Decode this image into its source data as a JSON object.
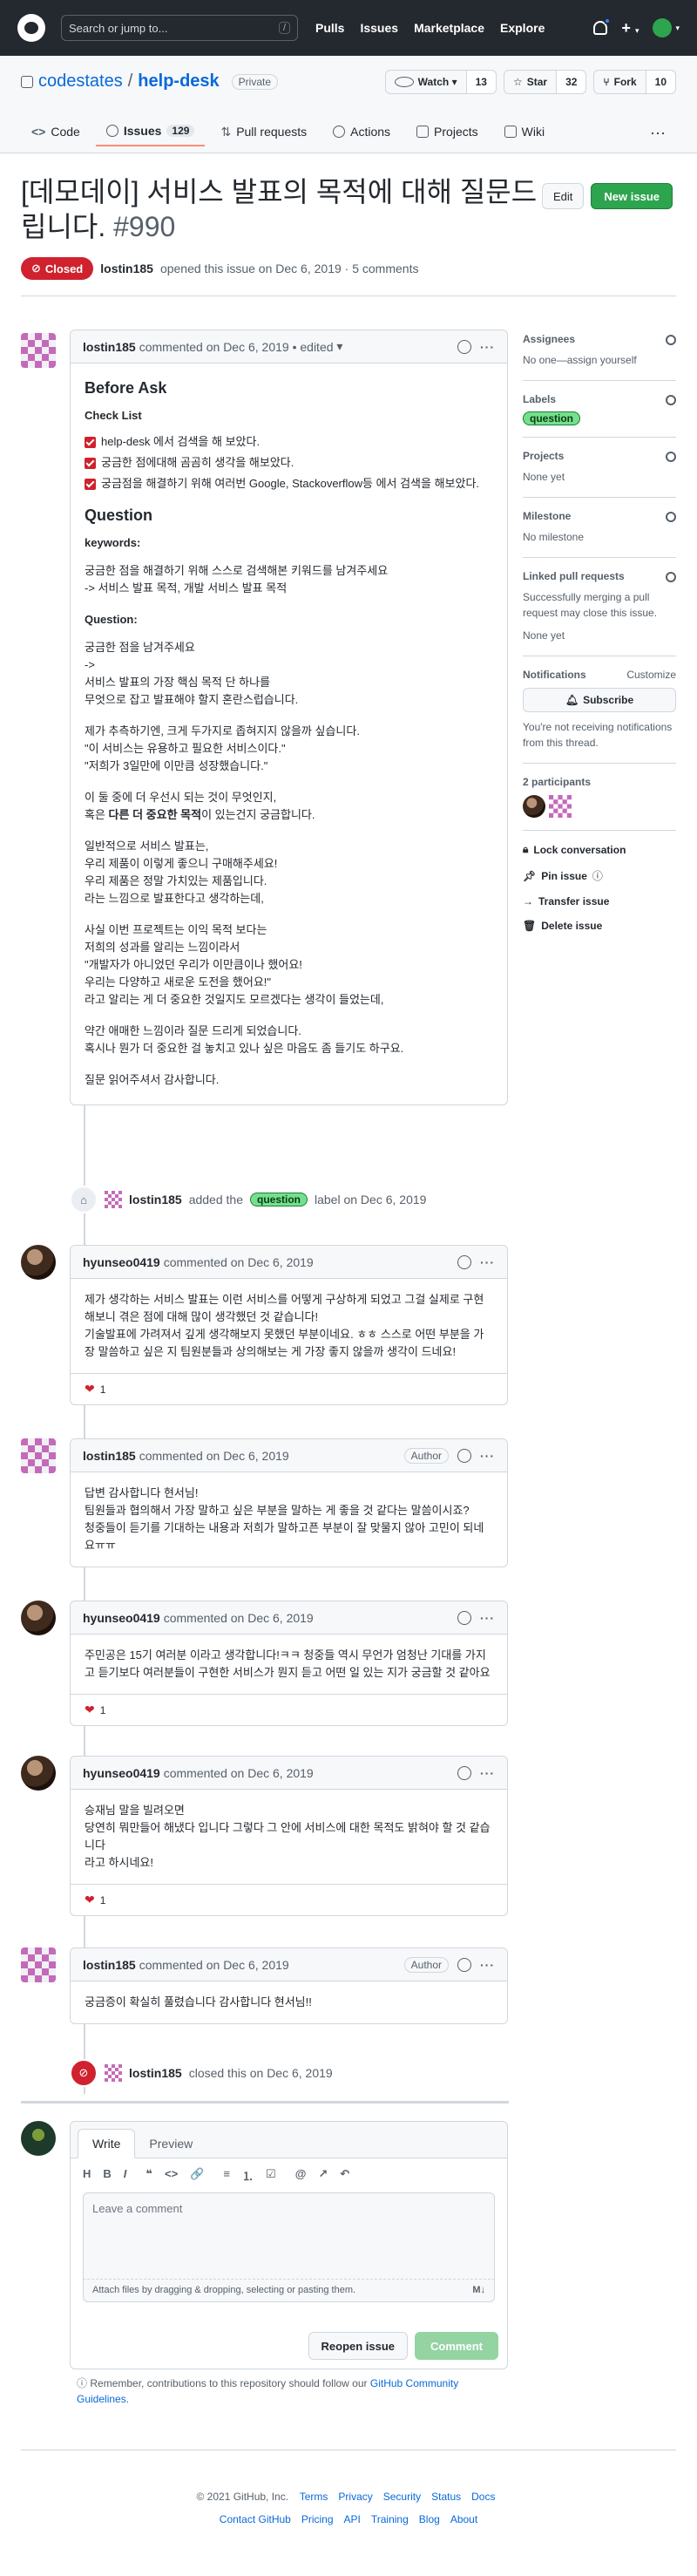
{
  "header": {
    "search_placeholder": "Search or jump to...",
    "search_key": "/",
    "nav": [
      "Pulls",
      "Issues",
      "Marketplace",
      "Explore"
    ],
    "plus": "+",
    "caret": "▾"
  },
  "repo": {
    "owner": "codestates",
    "name": "help-desk",
    "visibility": "Private",
    "buttons": {
      "watch": "Watch",
      "watch_count": "13",
      "star": "Star",
      "star_count": "32",
      "fork": "Fork",
      "fork_count": "10"
    },
    "tabs": [
      {
        "label": "Code"
      },
      {
        "label": "Issues",
        "count": "129"
      },
      {
        "label": "Pull requests"
      },
      {
        "label": "Actions"
      },
      {
        "label": "Projects"
      },
      {
        "label": "Wiki"
      }
    ],
    "more": "···"
  },
  "issue": {
    "title": "[데모데이] 서비스 발표의 목적에 대해 질문드립니다.",
    "number": "#990",
    "edit_label": "Edit",
    "new_label": "New issue",
    "state": "Closed",
    "author": "lostin185",
    "meta_text": "opened this issue on Dec 6, 2019 · 5 comments"
  },
  "first_comment": {
    "author": "lostin185",
    "header_text": "commented on Dec 6, 2019 • edited",
    "edited_caret": "▾",
    "before_ask": "Before Ask",
    "check_list": "Check List",
    "checks": [
      "help-desk 에서 검색을 해 보았다.",
      "궁금한 점에대해 곰곰히 생각을 해보았다.",
      "궁금점을 해결하기 위해 여러번 Google, Stackoverflow등 에서 검색을 해보았다."
    ],
    "question_h": "Question",
    "keywords_h": "keywords:",
    "keywords_lines": [
      "궁금한 점을 해결하기 위해 스스로 검색해본 키워드를 남겨주세요",
      "-> 서비스 발표 목적, 개발 서비스 발표 목적"
    ],
    "question_label": "Question:",
    "p1": [
      "궁금한 점을 남겨주세요",
      "->",
      "서비스 발표의 가장 핵심 목적 단 하나를",
      "무엇으로 잡고 발표해야 할지 혼란스럽습니다."
    ],
    "p2": [
      "제가 추측하기엔, 크게 두가지로 좁혀지지 않을까 싶습니다.",
      "\"이 서비스는 유용하고 필요한 서비스이다.\"",
      "\"저희가 3일만에 이만큼 성장했습니다.\""
    ],
    "p3a": "이 둘 중에 더 우선시 되는 것이 무엇인지,",
    "p3b_pre": "혹은 ",
    "p3b_bold": "다른 더 중요한 목적",
    "p3b_post": "이 있는건지 궁금합니다.",
    "p4": [
      "일반적으로 서비스 발표는,",
      "우리 제품이 이렇게 좋으니 구매해주세요!",
      "우리 제품은 정말 가치있는 제품입니다.",
      "라는 느낌으로 발표한다고 생각하는데,"
    ],
    "p5": [
      "사실 이번 프로젝트는 이익 목적 보다는",
      "저희의 성과를 알리는 느낌이라서",
      "\"개발자가 아니었던 우리가 이만큼이나 했어요!",
      "우리는 다양하고 새로운 도전을 했어요!\"",
      "라고 알리는 게 더 중요한 것일지도 모르겠다는 생각이 들었는데,"
    ],
    "p6": [
      "약간 애매한 느낌이라 질문 드리게 되었습니다.",
      "혹시나 뭔가 더 중요한 걸 놓치고 있나 싶은 마음도 좀 들기도 하구요."
    ],
    "p7": "질문 읽어주셔서 감사합니다."
  },
  "label_event": {
    "author": "lostin185",
    "pre": "added the",
    "label": "question",
    "post": "label on Dec 6, 2019"
  },
  "comments": [
    {
      "author": "hyunseo0419",
      "date": "commented on Dec 6, 2019",
      "body": [
        "제가 생각하는 서비스 발표는 이런 서비스를 어떻게 구상하게 되었고 그걸 실제로 구현해보니 겪은 점에 대해 많이 생각했던 것 같습니다!",
        "기술발표에 가려져서 깊게 생각해보지 못했던 부분이네요. ㅎㅎ 스스로 어떤 부분을 가장 말씀하고 싶은 지 팀원분들과 상의해보는 게 가장 좋지 않을까 생각이 드네요!"
      ],
      "reaction": "1"
    },
    {
      "author": "lostin185",
      "date": "commented on Dec 6, 2019",
      "badge": "Author",
      "body": [
        "답변 감사합니다 현서님!",
        "팀원들과 협의해서 가장 말하고 싶은 부분을 말하는 게 좋을 것 같다는 말씀이시죠?",
        "청중들이 듣기를 기대하는 내용과 저희가 말하고픈 부분이 잘 맞물지 않아 고민이 되네요ㅠㅠ"
      ]
    },
    {
      "author": "hyunseo0419",
      "date": "commented on Dec 6, 2019",
      "body": [
        "주민공은 15기 여러분 이라고 생각합니다!ㅋㅋ 청중들 역시 무언가 엄청난 기대를 가지고 듣기보다 여러분들이 구현한 서비스가 뭔지 듣고 어떤 일 있는 지가 궁금할 것 같아요"
      ],
      "reaction": "1"
    },
    {
      "author": "hyunseo0419",
      "date": "commented on Dec 6, 2019",
      "body": [
        "승재님 말을 빌려오면",
        "당연히 뭐만들어 해냈다 입니다 그렇다 그 안에 서비스에 대한 목적도 밝혀야 할 것 같습니다",
        "라고 하시네요!"
      ],
      "reaction": "1"
    },
    {
      "author": "lostin185",
      "date": "commented on Dec 6, 2019",
      "badge": "Author",
      "body": [
        "궁금증이 확실히 풀렸습니다 감사합니다 현서님!!"
      ]
    }
  ],
  "closed_event": {
    "author": "lostin185",
    "text": "closed this on Dec 6, 2019"
  },
  "sidebar": {
    "assignees": "Assignees",
    "assignees_val": "No one—assign yourself",
    "labels": "Labels",
    "label_val": "question",
    "projects": "Projects",
    "projects_val": "None yet",
    "milestone": "Milestone",
    "milestone_val": "No milestone",
    "linked": "Linked pull requests",
    "linked_desc": "Successfully merging a pull request may close this issue.",
    "linked_val": "None yet",
    "notifications": "Notifications",
    "customize": "Customize",
    "subscribe": "Subscribe",
    "notif_desc": "You're not receiving notifications from this thread.",
    "participants": "2 participants",
    "actions": [
      "Lock conversation",
      "Pin issue",
      "Transfer issue",
      "Delete issue"
    ]
  },
  "new_comment": {
    "tab_write": "Write",
    "tab_preview": "Preview",
    "toolbar": [
      "H",
      "B",
      "I",
      "❝",
      "<>",
      "🔗",
      "≡",
      "⒈",
      "☑",
      "@",
      "↗",
      "↶"
    ],
    "placeholder": "Leave a comment",
    "attach": "Attach files by dragging & dropping, selecting or pasting them.",
    "md": "M↓",
    "reopen": "Reopen issue",
    "comment": "Comment"
  },
  "remember": {
    "pre": "Remember, contributions to this repository should follow our",
    "link": "GitHub Community Guidelines",
    "post": "."
  },
  "footer": {
    "copyright": "© 2021 GitHub, Inc.",
    "row1": [
      "Terms",
      "Privacy",
      "Security",
      "Status",
      "Docs"
    ],
    "row2": [
      "Contact GitHub",
      "Pricing",
      "API",
      "Training",
      "Blog",
      "About"
    ]
  },
  "colors": {
    "header_bg": "#24292f",
    "closed": "#cf222e",
    "accent": "#2da44e",
    "link": "#0969da"
  }
}
